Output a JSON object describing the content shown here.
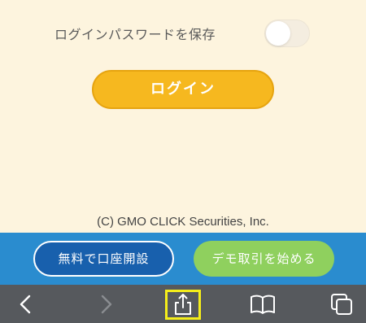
{
  "settings": {
    "save_password_label": "ログインパスワードを保存",
    "save_password_enabled": false
  },
  "login": {
    "button_label": "ログイン"
  },
  "footer": {
    "copyright": "(C) GMO CLICK Securities, Inc."
  },
  "cta": {
    "open_account_label": "無料で口座開設",
    "demo_label": "デモ取引を始める"
  },
  "toolbar": {
    "items": [
      {
        "icon": "back-icon"
      },
      {
        "icon": "forward-icon"
      },
      {
        "icon": "share-icon",
        "highlighted": true
      },
      {
        "icon": "bookmarks-icon"
      },
      {
        "icon": "tabs-icon"
      }
    ]
  },
  "colors": {
    "background": "#fdf4de",
    "login_button": "#f6b81f",
    "cta_bar": "#2a8ccf",
    "open_account_button": "#1860ad",
    "demo_button": "#8fd05e",
    "toolbar": "#56595d",
    "highlight": "#f5ee1a"
  }
}
